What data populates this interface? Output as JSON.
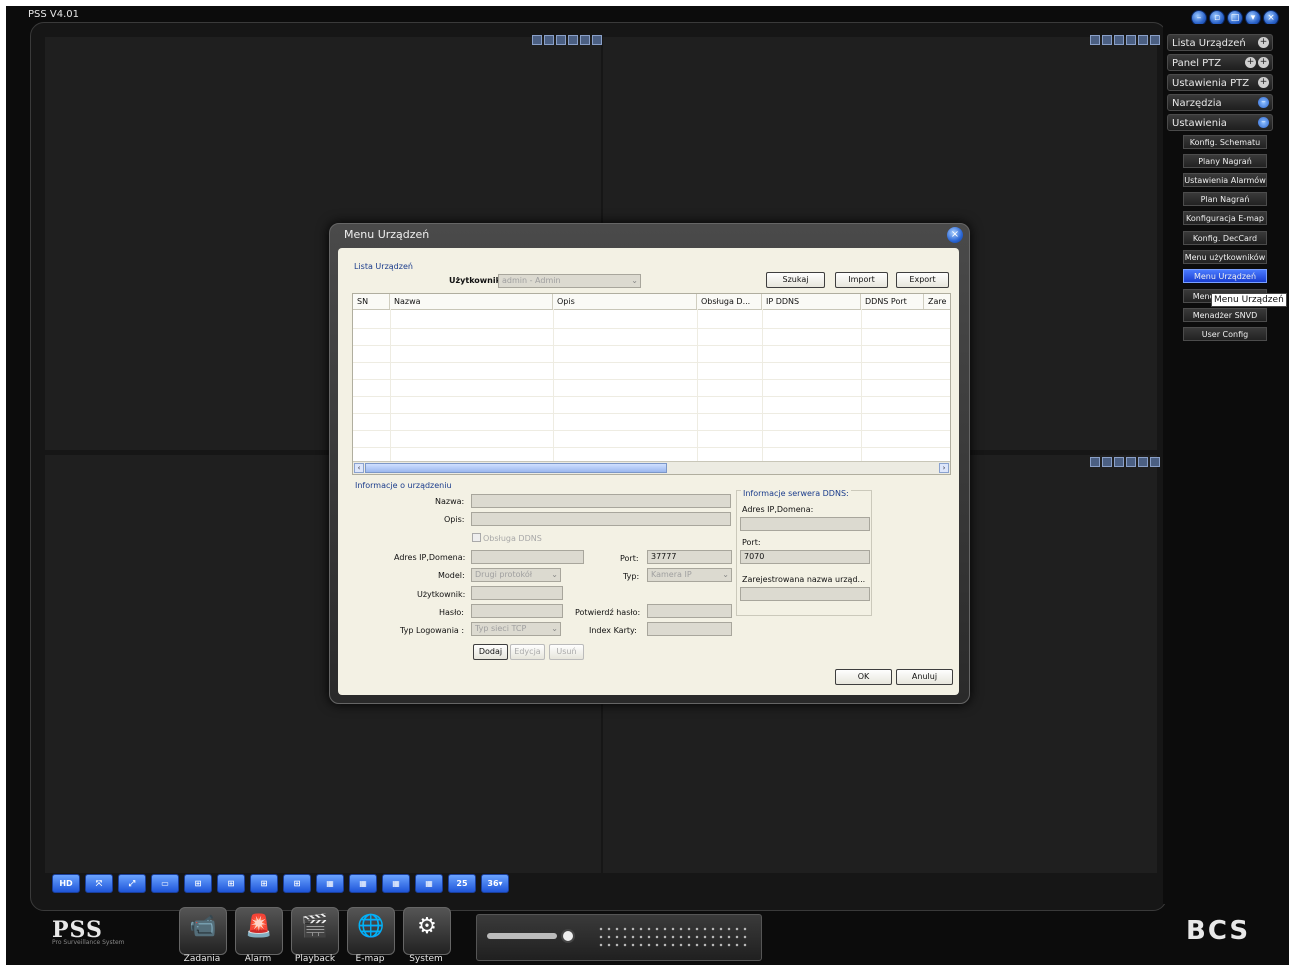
{
  "app": {
    "title": "PSS V4.01",
    "window_controls": [
      "min",
      "restore",
      "max",
      "tray",
      "close"
    ]
  },
  "right_panel": {
    "menu": [
      {
        "label": "Lista Urządzeń",
        "icon": "plus-icon"
      },
      {
        "label": "Panel PTZ",
        "icon": "plus-icon"
      },
      {
        "label": "Ustawienia PTZ",
        "icon": "plus-icon"
      },
      {
        "label": "Narzędzia",
        "icon": "minus-icon"
      },
      {
        "label": "Ustawienia",
        "icon": "minus-icon"
      }
    ],
    "submenu": [
      "Konfig. Schematu",
      "Plany Nagrań",
      "Ustawienia Alarmów",
      "Plan Nagrań",
      "Konfiguracja E-map",
      "Konfig. DecCard",
      "Menu użytkowników",
      "Menu Urządzeń",
      "Menedżer SNVD",
      "Menadżer SNVD",
      "User Config"
    ],
    "active_sub": "Menu Urządzeń",
    "tooltip": "Menu Urządzeń"
  },
  "layout_bar": {
    "buttons": [
      "HD",
      "",
      "",
      "",
      "",
      "",
      "",
      "",
      "",
      "",
      "",
      "",
      "25",
      "36▾"
    ]
  },
  "bottom": {
    "logo": "PSS",
    "logo_sub": "Pro Surveillance System",
    "tools": [
      "Zadania",
      "Alarm",
      "Playback",
      "E-map",
      "System"
    ],
    "brand": "BCS"
  },
  "dialog": {
    "title": "Menu Urządzeń",
    "list_section": "Lista Urządzeń",
    "user_label": "Użytkownik:",
    "user_value": "admin - Admin",
    "search_btn": "Szukaj",
    "import_btn": "Import",
    "export_btn": "Export",
    "columns": [
      "SN",
      "Nazwa",
      "Opis",
      "Obsługa D...",
      "IP DDNS",
      "DDNS Port",
      "Zare"
    ],
    "info_section": "Informacje o urządzeniu",
    "name_label": "Nazwa:",
    "name_value": "",
    "desc_label": "Opis:",
    "desc_value": "",
    "ddns_check_label": "Obsługa DDNS",
    "ip_label": "Adres IP,Domena:",
    "ip_value": "",
    "port_label": "Port:",
    "port_value": "37777",
    "model_label": "Model:",
    "model_value": "Drugi protokół",
    "type_label": "Typ:",
    "type_value": "Kamera IP",
    "user2_label": "Użytkownik:",
    "user2_value": "",
    "pass_label": "Hasło:",
    "pass_value": "",
    "confirm_label": "Potwierdź hasło:",
    "confirm_value": "",
    "login_type_label": "Typ Logowania :",
    "login_type_value": "Typ sieci TCP",
    "card_label": "Index Karty:",
    "card_value": "",
    "add_btn": "Dodaj",
    "edit_btn": "Edycja",
    "delete_btn": "Usuń",
    "ddns_section": "Informacje serwera DDNS:",
    "ddns_ip_label": "Adres IP,Domena:",
    "ddns_ip_value": "",
    "ddns_port_label": "Port:",
    "ddns_port_value": "7070",
    "ddns_reg_label": "Zarejestrowana nazwa urząd...",
    "ddns_reg_value": "",
    "ok_btn": "OK",
    "cancel_btn": "Anuluj"
  }
}
